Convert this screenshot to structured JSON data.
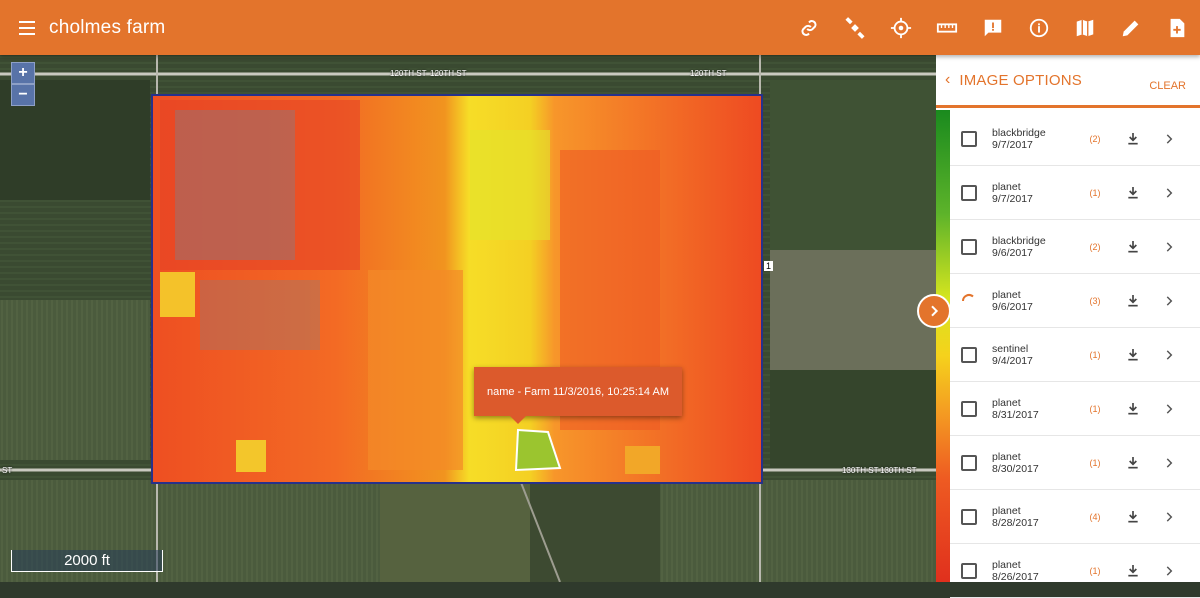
{
  "header": {
    "title": "cholmes farm",
    "tools": [
      {
        "name": "link-icon"
      },
      {
        "name": "satellite-icon"
      },
      {
        "name": "crosshair-icon"
      },
      {
        "name": "ruler-icon"
      },
      {
        "name": "report-icon"
      },
      {
        "name": "info-icon"
      },
      {
        "name": "map-icon"
      },
      {
        "name": "pencil-icon"
      },
      {
        "name": "add-document-icon"
      }
    ]
  },
  "map": {
    "zoom_in": "+",
    "zoom_out": "−",
    "road_labels": [
      "120TH ST",
      "120TH ST",
      "120TH ST",
      "130TH ST",
      "130TH ST",
      "ST",
      "ST"
    ],
    "popup": "name - Farm 11/3/2016, 10:25:14 AM",
    "scale": "2000 ft",
    "marker": "1",
    "colors": {
      "accent": "#e3742c",
      "popup": "#dc5a2c",
      "ndvi_low": "#e0301d",
      "ndvi_high": "#1a8a1e"
    }
  },
  "panel": {
    "back": "‹",
    "title": "IMAGE OPTIONS",
    "clear": "CLEAR",
    "items": [
      {
        "source": "blackbridge",
        "date": "9/7/2017",
        "count": "(2)",
        "state": "checkbox"
      },
      {
        "source": "planet",
        "date": "9/7/2017",
        "count": "(1)",
        "state": "checkbox"
      },
      {
        "source": "blackbridge",
        "date": "9/6/2017",
        "count": "(2)",
        "state": "checkbox"
      },
      {
        "source": "planet",
        "date": "9/6/2017",
        "count": "(3)",
        "state": "loading"
      },
      {
        "source": "sentinel",
        "date": "9/4/2017",
        "count": "(1)",
        "state": "checkbox"
      },
      {
        "source": "planet",
        "date": "8/31/2017",
        "count": "(1)",
        "state": "checkbox"
      },
      {
        "source": "planet",
        "date": "8/30/2017",
        "count": "(1)",
        "state": "checkbox"
      },
      {
        "source": "planet",
        "date": "8/28/2017",
        "count": "(4)",
        "state": "checkbox"
      },
      {
        "source": "planet",
        "date": "8/26/2017",
        "count": "(1)",
        "state": "checkbox"
      }
    ]
  }
}
